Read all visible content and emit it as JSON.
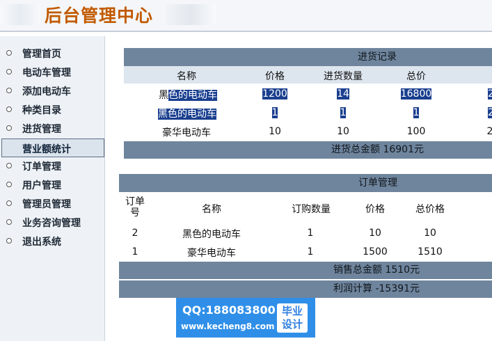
{
  "header": {
    "title": "后台管理中心"
  },
  "sidebar": {
    "items": [
      {
        "label": "管理首页"
      },
      {
        "label": "电动车管理"
      },
      {
        "label": "添加电动车"
      },
      {
        "label": "种类目录"
      },
      {
        "label": "进货管理"
      },
      {
        "label": "营业额统计",
        "active": true
      },
      {
        "label": "订单管理"
      },
      {
        "label": "用户管理"
      },
      {
        "label": "管理员管理"
      },
      {
        "label": "业务咨询管理"
      },
      {
        "label": "退出系统"
      }
    ]
  },
  "purchase": {
    "title": "进货记录",
    "headers": [
      "名称",
      "价格",
      "进货数量",
      "总价"
    ],
    "rows": [
      {
        "name": "黑色的电动车",
        "price": "1200",
        "qty": "14",
        "total": "16800",
        "extra": "2"
      },
      {
        "name": "黑色的电动车",
        "price": "1",
        "qty": "1",
        "total": "1",
        "extra": "2"
      },
      {
        "name": "豪华电动车",
        "price": "10",
        "qty": "10",
        "total": "100",
        "extra": "2"
      }
    ],
    "total_label": "进货总金额  16901元"
  },
  "orders": {
    "title": "订单管理",
    "headers": [
      "订单号",
      "名称",
      "订购数量",
      "价格",
      "总价格"
    ],
    "rows": [
      {
        "id": "2",
        "name": "黑色的电动车",
        "qty": "1",
        "price": "10",
        "total": "10"
      },
      {
        "id": "1",
        "name": "豪华电动车",
        "qty": "1",
        "price": "1500",
        "total": "1510"
      }
    ],
    "sales_label": "销售总金额  1510元",
    "profit_label": "利润计算  -15391元"
  },
  "watermark": {
    "qq": "QQ:188083800",
    "url": "www.kecheng8.com",
    "badge_line1": "毕业",
    "badge_line2": "设计"
  },
  "colors": {
    "title": "#c25a00",
    "bar": "#6f859d",
    "highlight": "#1a3f8f",
    "watermark": "#2f8fe8"
  }
}
